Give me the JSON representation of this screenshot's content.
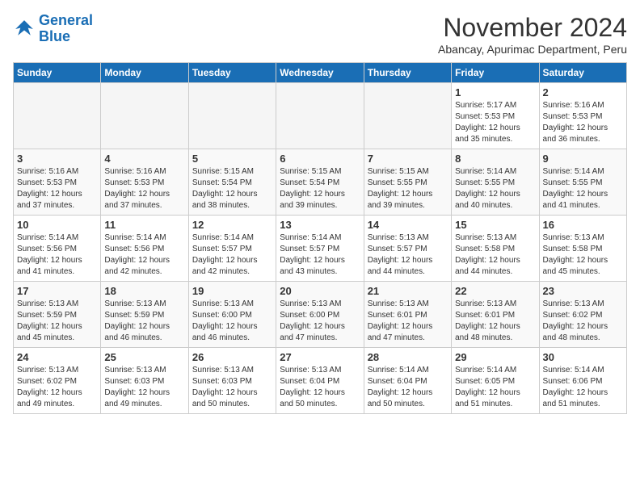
{
  "logo": {
    "line1": "General",
    "line2": "Blue"
  },
  "title": "November 2024",
  "subtitle": "Abancay, Apurimac Department, Peru",
  "days_of_week": [
    "Sunday",
    "Monday",
    "Tuesday",
    "Wednesday",
    "Thursday",
    "Friday",
    "Saturday"
  ],
  "weeks": [
    [
      {
        "day": "",
        "info": ""
      },
      {
        "day": "",
        "info": ""
      },
      {
        "day": "",
        "info": ""
      },
      {
        "day": "",
        "info": ""
      },
      {
        "day": "",
        "info": ""
      },
      {
        "day": "1",
        "info": "Sunrise: 5:17 AM\nSunset: 5:53 PM\nDaylight: 12 hours\nand 35 minutes."
      },
      {
        "day": "2",
        "info": "Sunrise: 5:16 AM\nSunset: 5:53 PM\nDaylight: 12 hours\nand 36 minutes."
      }
    ],
    [
      {
        "day": "3",
        "info": "Sunrise: 5:16 AM\nSunset: 5:53 PM\nDaylight: 12 hours\nand 37 minutes."
      },
      {
        "day": "4",
        "info": "Sunrise: 5:16 AM\nSunset: 5:53 PM\nDaylight: 12 hours\nand 37 minutes."
      },
      {
        "day": "5",
        "info": "Sunrise: 5:15 AM\nSunset: 5:54 PM\nDaylight: 12 hours\nand 38 minutes."
      },
      {
        "day": "6",
        "info": "Sunrise: 5:15 AM\nSunset: 5:54 PM\nDaylight: 12 hours\nand 39 minutes."
      },
      {
        "day": "7",
        "info": "Sunrise: 5:15 AM\nSunset: 5:55 PM\nDaylight: 12 hours\nand 39 minutes."
      },
      {
        "day": "8",
        "info": "Sunrise: 5:14 AM\nSunset: 5:55 PM\nDaylight: 12 hours\nand 40 minutes."
      },
      {
        "day": "9",
        "info": "Sunrise: 5:14 AM\nSunset: 5:55 PM\nDaylight: 12 hours\nand 41 minutes."
      }
    ],
    [
      {
        "day": "10",
        "info": "Sunrise: 5:14 AM\nSunset: 5:56 PM\nDaylight: 12 hours\nand 41 minutes."
      },
      {
        "day": "11",
        "info": "Sunrise: 5:14 AM\nSunset: 5:56 PM\nDaylight: 12 hours\nand 42 minutes."
      },
      {
        "day": "12",
        "info": "Sunrise: 5:14 AM\nSunset: 5:57 PM\nDaylight: 12 hours\nand 42 minutes."
      },
      {
        "day": "13",
        "info": "Sunrise: 5:14 AM\nSunset: 5:57 PM\nDaylight: 12 hours\nand 43 minutes."
      },
      {
        "day": "14",
        "info": "Sunrise: 5:13 AM\nSunset: 5:57 PM\nDaylight: 12 hours\nand 44 minutes."
      },
      {
        "day": "15",
        "info": "Sunrise: 5:13 AM\nSunset: 5:58 PM\nDaylight: 12 hours\nand 44 minutes."
      },
      {
        "day": "16",
        "info": "Sunrise: 5:13 AM\nSunset: 5:58 PM\nDaylight: 12 hours\nand 45 minutes."
      }
    ],
    [
      {
        "day": "17",
        "info": "Sunrise: 5:13 AM\nSunset: 5:59 PM\nDaylight: 12 hours\nand 45 minutes."
      },
      {
        "day": "18",
        "info": "Sunrise: 5:13 AM\nSunset: 5:59 PM\nDaylight: 12 hours\nand 46 minutes."
      },
      {
        "day": "19",
        "info": "Sunrise: 5:13 AM\nSunset: 6:00 PM\nDaylight: 12 hours\nand 46 minutes."
      },
      {
        "day": "20",
        "info": "Sunrise: 5:13 AM\nSunset: 6:00 PM\nDaylight: 12 hours\nand 47 minutes."
      },
      {
        "day": "21",
        "info": "Sunrise: 5:13 AM\nSunset: 6:01 PM\nDaylight: 12 hours\nand 47 minutes."
      },
      {
        "day": "22",
        "info": "Sunrise: 5:13 AM\nSunset: 6:01 PM\nDaylight: 12 hours\nand 48 minutes."
      },
      {
        "day": "23",
        "info": "Sunrise: 5:13 AM\nSunset: 6:02 PM\nDaylight: 12 hours\nand 48 minutes."
      }
    ],
    [
      {
        "day": "24",
        "info": "Sunrise: 5:13 AM\nSunset: 6:02 PM\nDaylight: 12 hours\nand 49 minutes."
      },
      {
        "day": "25",
        "info": "Sunrise: 5:13 AM\nSunset: 6:03 PM\nDaylight: 12 hours\nand 49 minutes."
      },
      {
        "day": "26",
        "info": "Sunrise: 5:13 AM\nSunset: 6:03 PM\nDaylight: 12 hours\nand 50 minutes."
      },
      {
        "day": "27",
        "info": "Sunrise: 5:13 AM\nSunset: 6:04 PM\nDaylight: 12 hours\nand 50 minutes."
      },
      {
        "day": "28",
        "info": "Sunrise: 5:14 AM\nSunset: 6:04 PM\nDaylight: 12 hours\nand 50 minutes."
      },
      {
        "day": "29",
        "info": "Sunrise: 5:14 AM\nSunset: 6:05 PM\nDaylight: 12 hours\nand 51 minutes."
      },
      {
        "day": "30",
        "info": "Sunrise: 5:14 AM\nSunset: 6:06 PM\nDaylight: 12 hours\nand 51 minutes."
      }
    ]
  ]
}
